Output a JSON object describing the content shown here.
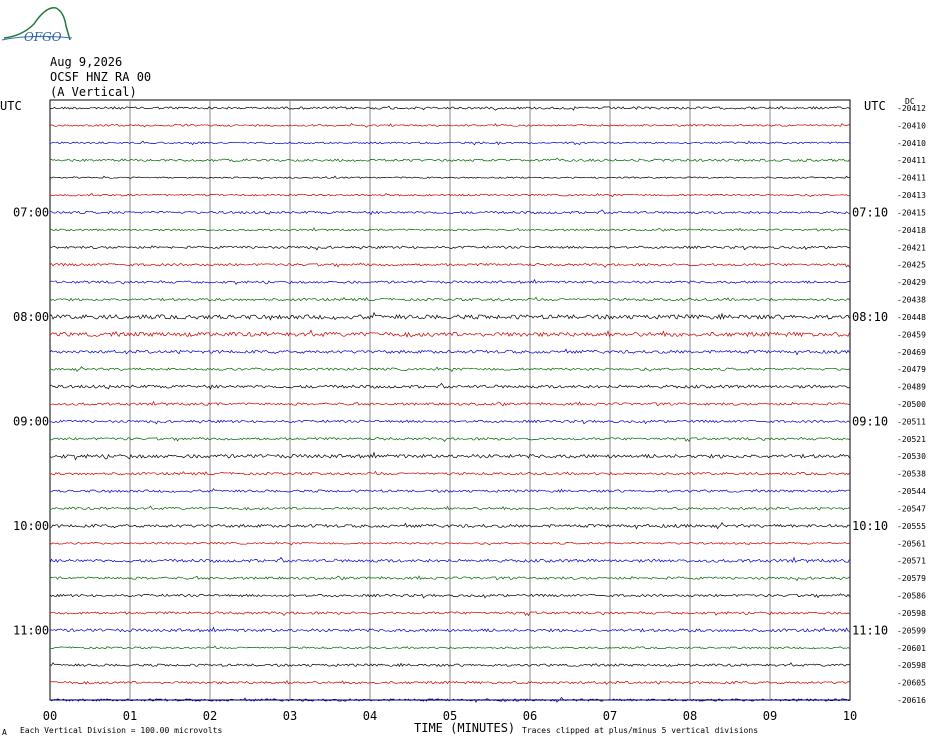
{
  "logo": {
    "text": "OFGO"
  },
  "header": {
    "date": "Aug 9,2026",
    "station": "OCSF HNZ RA 00",
    "component": "(A Vertical)"
  },
  "chart_data": {
    "type": "line",
    "title": "",
    "xlabel": "TIME (MINUTES)",
    "left_axis_label": "UTC",
    "right_axis_label": "UTC",
    "right_corner_label": "DC",
    "xlim": [
      0,
      10
    ],
    "x_ticks": [
      "00",
      "01",
      "02",
      "03",
      "04",
      "05",
      "06",
      "07",
      "08",
      "09",
      "10"
    ],
    "left_time_labels": [
      {
        "row": 6,
        "text": "07:00"
      },
      {
        "row": 12,
        "text": "08:00"
      },
      {
        "row": 18,
        "text": "09:00"
      },
      {
        "row": 24,
        "text": "10:00"
      },
      {
        "row": 30,
        "text": "11:00"
      }
    ],
    "right_time_labels": [
      {
        "row": 6,
        "text": "07:10"
      },
      {
        "row": 12,
        "text": "08:10"
      },
      {
        "row": 18,
        "text": "09:10"
      },
      {
        "row": 24,
        "text": "10:10"
      },
      {
        "row": 30,
        "text": "11:10"
      }
    ],
    "trace_colors": [
      "#000000",
      "#cc0000",
      "#0000cc",
      "#006600"
    ],
    "traces_dc_offsets": [
      -20412,
      -20410,
      -20410,
      -20411,
      -20411,
      -20413,
      -20415,
      -20418,
      -20421,
      -20425,
      -20429,
      -20438,
      -20448,
      -20459,
      -20469,
      -20479,
      -20489,
      -20500,
      -20511,
      -20521,
      -20530,
      -20538,
      -20544,
      -20547,
      -20555,
      -20561,
      -20571,
      -20579,
      -20586,
      -20598,
      -20599,
      -20601,
      -20598,
      -20605,
      -20616
    ],
    "trace_amplitude_divisions": [
      0.2,
      0.15,
      0.15,
      0.2,
      0.12,
      0.15,
      0.2,
      0.15,
      0.2,
      0.2,
      0.2,
      0.2,
      0.35,
      0.35,
      0.25,
      0.2,
      0.25,
      0.2,
      0.2,
      0.2,
      0.3,
      0.2,
      0.2,
      0.2,
      0.25,
      0.15,
      0.25,
      0.2,
      0.2,
      0.2,
      0.25,
      0.15,
      0.2,
      0.2,
      0.2
    ]
  },
  "footer": {
    "scale_note": "Each Vertical Division =  100.00 microvolts",
    "clip_note": "Traces clipped at plus/minus 5 vertical divisions",
    "corner_mark": "A"
  }
}
